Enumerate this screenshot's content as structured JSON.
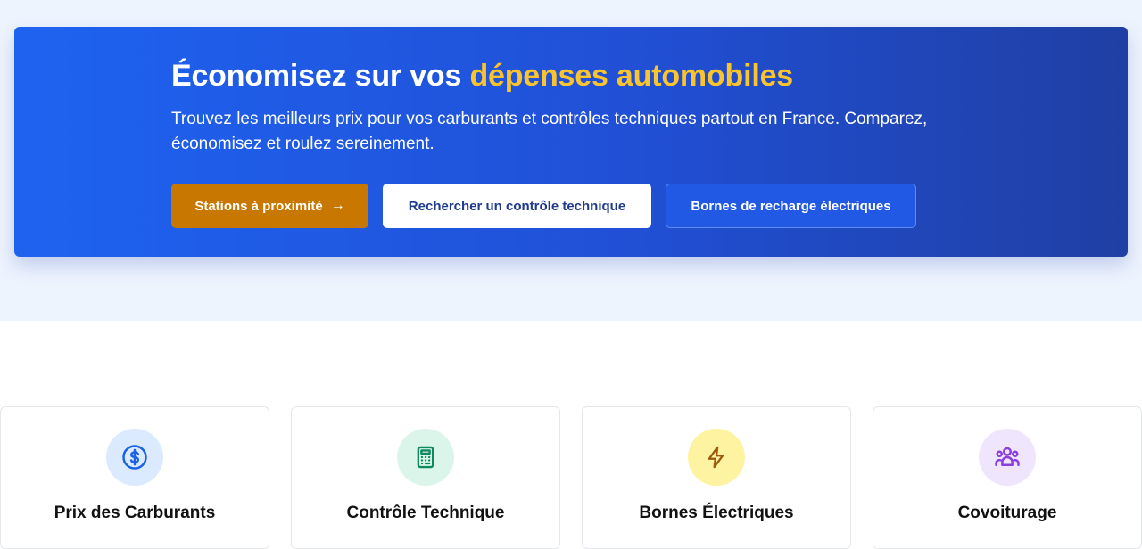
{
  "hero": {
    "title_prefix": "Économisez sur vos ",
    "title_highlight": "dépenses automobiles",
    "subtitle": "Trouvez les meilleurs prix pour vos carburants et contrôles techniques partout en France. Comparez, économisez et roulez sereinement.",
    "buttons": {
      "stations": "Stations à proximité",
      "controle": "Rechercher un contrôle technique",
      "bornes": "Bornes de recharge électriques"
    }
  },
  "features": [
    {
      "title": "Prix des Carburants",
      "icon": "dollar-circle-icon",
      "color": "#1a63e6",
      "bg": "#dbeafe"
    },
    {
      "title": "Contrôle Technique",
      "icon": "calculator-icon",
      "color": "#0f8a5f",
      "bg": "#dcf5ea"
    },
    {
      "title": "Bornes Électriques",
      "icon": "lightning-icon",
      "color": "#9a5b0b",
      "bg": "#fef3a0"
    },
    {
      "title": "Covoiturage",
      "icon": "users-icon",
      "color": "#8b3fe0",
      "bg": "#efe6fd"
    }
  ],
  "colors": {
    "hero_start": "#1e63f0",
    "hero_end": "#1f3fa3",
    "highlight": "#fcc42c",
    "primary_button": "#c87800"
  }
}
